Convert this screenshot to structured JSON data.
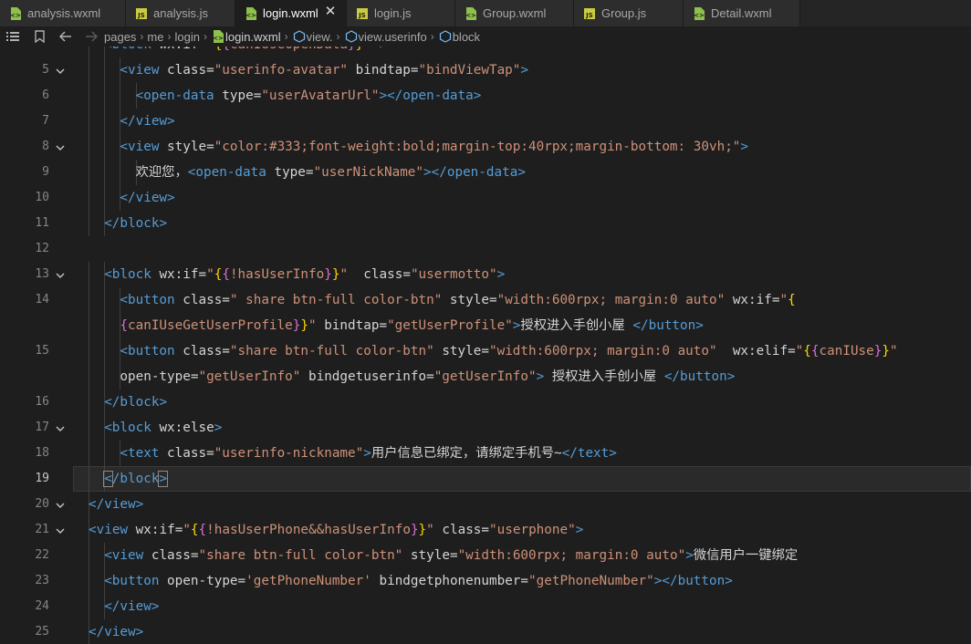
{
  "tabs": [
    {
      "label": "analysis.wxml",
      "type": "wxml",
      "active": false
    },
    {
      "label": "analysis.js",
      "type": "js",
      "active": false
    },
    {
      "label": "login.wxml",
      "type": "wxml",
      "active": true
    },
    {
      "label": "login.js",
      "type": "js",
      "active": false
    },
    {
      "label": "Group.wxml",
      "type": "wxml",
      "active": false
    },
    {
      "label": "Group.js",
      "type": "js",
      "active": false
    },
    {
      "label": "Detail.wxml",
      "type": "wxml",
      "active": false
    }
  ],
  "breadcrumb": [
    "pages",
    "me",
    "login",
    "login.wxml",
    "view.",
    "view.userinfo",
    "block"
  ],
  "colors": {
    "wxml_icon": "#8dc149",
    "js_icon": "#cbcb41",
    "tag": "#569cd6",
    "string": "#ce9178",
    "brace": "#ffd700"
  },
  "current_line": "19",
  "lines": [
    {
      "n": "",
      "text": "<block wx:if=\"{{canIUseOpenData}}\" >",
      "partial": true
    },
    {
      "n": "5",
      "text": "<view class=\"userinfo-avatar\" bindtap=\"bindViewTap\">"
    },
    {
      "n": "6",
      "text": "<open-data type=\"userAvatarUrl\"></open-data>"
    },
    {
      "n": "7",
      "text": "</view>"
    },
    {
      "n": "8",
      "text": "<view style=\"color:#333;font-weight:bold;margin-top:40rpx;margin-bottom: 30vh;\">"
    },
    {
      "n": "9",
      "text": "欢迎您，<open-data type=\"userNickName\"></open-data>"
    },
    {
      "n": "10",
      "text": "</view>"
    },
    {
      "n": "11",
      "text": "</block>"
    },
    {
      "n": "12",
      "text": ""
    },
    {
      "n": "13",
      "text": "<block wx:if=\"{{!hasUserInfo}}\"  class=\"usermotto\">"
    },
    {
      "n": "14",
      "text": "<button class=\" share btn-full color-btn\" style=\"width:600rpx; margin:0 auto\" wx:if=\"{"
    },
    {
      "n": "",
      "text": "{canIUseGetUserProfile}}\" bindtap=\"getUserProfile\">授权进入手创小屋 </button>"
    },
    {
      "n": "15",
      "text": "<button class=\"share btn-full color-btn\" style=\"width:600rpx; margin:0 auto\"  wx:elif=\"{{canIUse}}\""
    },
    {
      "n": "",
      "text": "open-type=\"getUserInfo\" bindgetuserinfo=\"getUserInfo\"> 授权进入手创小屋 </button>"
    },
    {
      "n": "16",
      "text": "</block>"
    },
    {
      "n": "17",
      "text": "<block wx:else>"
    },
    {
      "n": "18",
      "text": "<text class=\"userinfo-nickname\">用户信息已绑定，请绑定手机号~</text>"
    },
    {
      "n": "19",
      "text": "</block>"
    },
    {
      "n": "20",
      "text": "</view>"
    },
    {
      "n": "21",
      "text": "<view wx:if=\"{{!hasUserPhone&&hasUserInfo}}\" class=\"userphone\">"
    },
    {
      "n": "22",
      "text": "<view class=\"share btn-full color-btn\" style=\"width:600rpx; margin:0 auto\">微信用户一键绑定"
    },
    {
      "n": "23",
      "text": "<button open-type='getPhoneNumber' bindgetphonenumber=\"getPhoneNumber\"></button>"
    },
    {
      "n": "24",
      "text": "</view>"
    },
    {
      "n": "25",
      "text": "</view>"
    }
  ]
}
